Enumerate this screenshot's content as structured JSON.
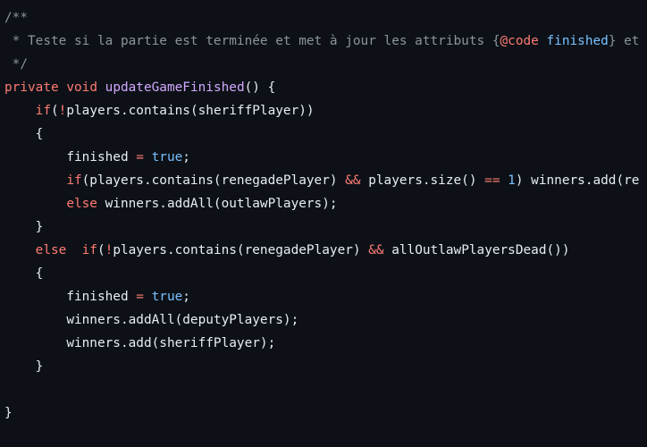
{
  "theme": {
    "background": "#0d1117",
    "text": "#e6edf3",
    "comment": "#8b949e",
    "keyword": "#ff7b72",
    "function": "#d2a8ff",
    "constant": "#79c0ff"
  },
  "code": {
    "language": "java",
    "lines": [
      [
        {
          "t": "comment",
          "v": "/**"
        }
      ],
      [
        {
          "t": "comment",
          "v": " * Teste si la partie est terminée et met à jour les attributs {"
        },
        {
          "t": "annotation",
          "v": "@code"
        },
        {
          "t": "comment",
          "v": " "
        },
        {
          "t": "doc-ident",
          "v": "finished"
        },
        {
          "t": "comment",
          "v": "} et"
        }
      ],
      [
        {
          "t": "comment",
          "v": " */"
        }
      ],
      [
        {
          "t": "keyword",
          "v": "private"
        },
        {
          "t": "space",
          "v": " "
        },
        {
          "t": "keyword",
          "v": "void"
        },
        {
          "t": "space",
          "v": " "
        },
        {
          "t": "function",
          "v": "updateGameFinished"
        },
        {
          "t": "punct",
          "v": "() {"
        }
      ],
      [
        {
          "t": "space",
          "v": "    "
        },
        {
          "t": "keyword",
          "v": "if"
        },
        {
          "t": "punct",
          "v": "("
        },
        {
          "t": "operator",
          "v": "!"
        },
        {
          "t": "ident",
          "v": "players.contains(sheriffPlayer))"
        }
      ],
      [
        {
          "t": "space",
          "v": "    "
        },
        {
          "t": "punct",
          "v": "{"
        }
      ],
      [
        {
          "t": "space",
          "v": "        "
        },
        {
          "t": "ident",
          "v": "finished"
        },
        {
          "t": "space",
          "v": " "
        },
        {
          "t": "operator",
          "v": "="
        },
        {
          "t": "space",
          "v": " "
        },
        {
          "t": "constant",
          "v": "true"
        },
        {
          "t": "punct",
          "v": ";"
        }
      ],
      [
        {
          "t": "space",
          "v": "        "
        },
        {
          "t": "keyword",
          "v": "if"
        },
        {
          "t": "punct",
          "v": "(players.contains(renegadePlayer) "
        },
        {
          "t": "operator",
          "v": "&&"
        },
        {
          "t": "ident",
          "v": " players.size() "
        },
        {
          "t": "operator",
          "v": "=="
        },
        {
          "t": "space",
          "v": " "
        },
        {
          "t": "number",
          "v": "1"
        },
        {
          "t": "ident",
          "v": ") winners.add(re"
        }
      ],
      [
        {
          "t": "space",
          "v": "        "
        },
        {
          "t": "keyword",
          "v": "else"
        },
        {
          "t": "ident",
          "v": " winners.addAll(outlawPlayers);"
        }
      ],
      [
        {
          "t": "space",
          "v": "    "
        },
        {
          "t": "punct",
          "v": "}"
        }
      ],
      [
        {
          "t": "space",
          "v": "    "
        },
        {
          "t": "keyword",
          "v": "else"
        },
        {
          "t": "space",
          "v": "  "
        },
        {
          "t": "keyword",
          "v": "if"
        },
        {
          "t": "punct",
          "v": "("
        },
        {
          "t": "operator",
          "v": "!"
        },
        {
          "t": "ident",
          "v": "players.contains(renegadePlayer) "
        },
        {
          "t": "operator",
          "v": "&&"
        },
        {
          "t": "ident",
          "v": " allOutlawPlayersDead())"
        }
      ],
      [
        {
          "t": "space",
          "v": "    "
        },
        {
          "t": "punct",
          "v": "{"
        }
      ],
      [
        {
          "t": "space",
          "v": "        "
        },
        {
          "t": "ident",
          "v": "finished"
        },
        {
          "t": "space",
          "v": " "
        },
        {
          "t": "operator",
          "v": "="
        },
        {
          "t": "space",
          "v": " "
        },
        {
          "t": "constant",
          "v": "true"
        },
        {
          "t": "punct",
          "v": ";"
        }
      ],
      [
        {
          "t": "space",
          "v": "        "
        },
        {
          "t": "ident",
          "v": "winners.addAll(deputyPlayers);"
        }
      ],
      [
        {
          "t": "space",
          "v": "        "
        },
        {
          "t": "ident",
          "v": "winners.add(sheriffPlayer);"
        }
      ],
      [
        {
          "t": "space",
          "v": "    "
        },
        {
          "t": "punct",
          "v": "}"
        }
      ],
      [],
      [
        {
          "t": "punct",
          "v": "}"
        }
      ]
    ]
  }
}
